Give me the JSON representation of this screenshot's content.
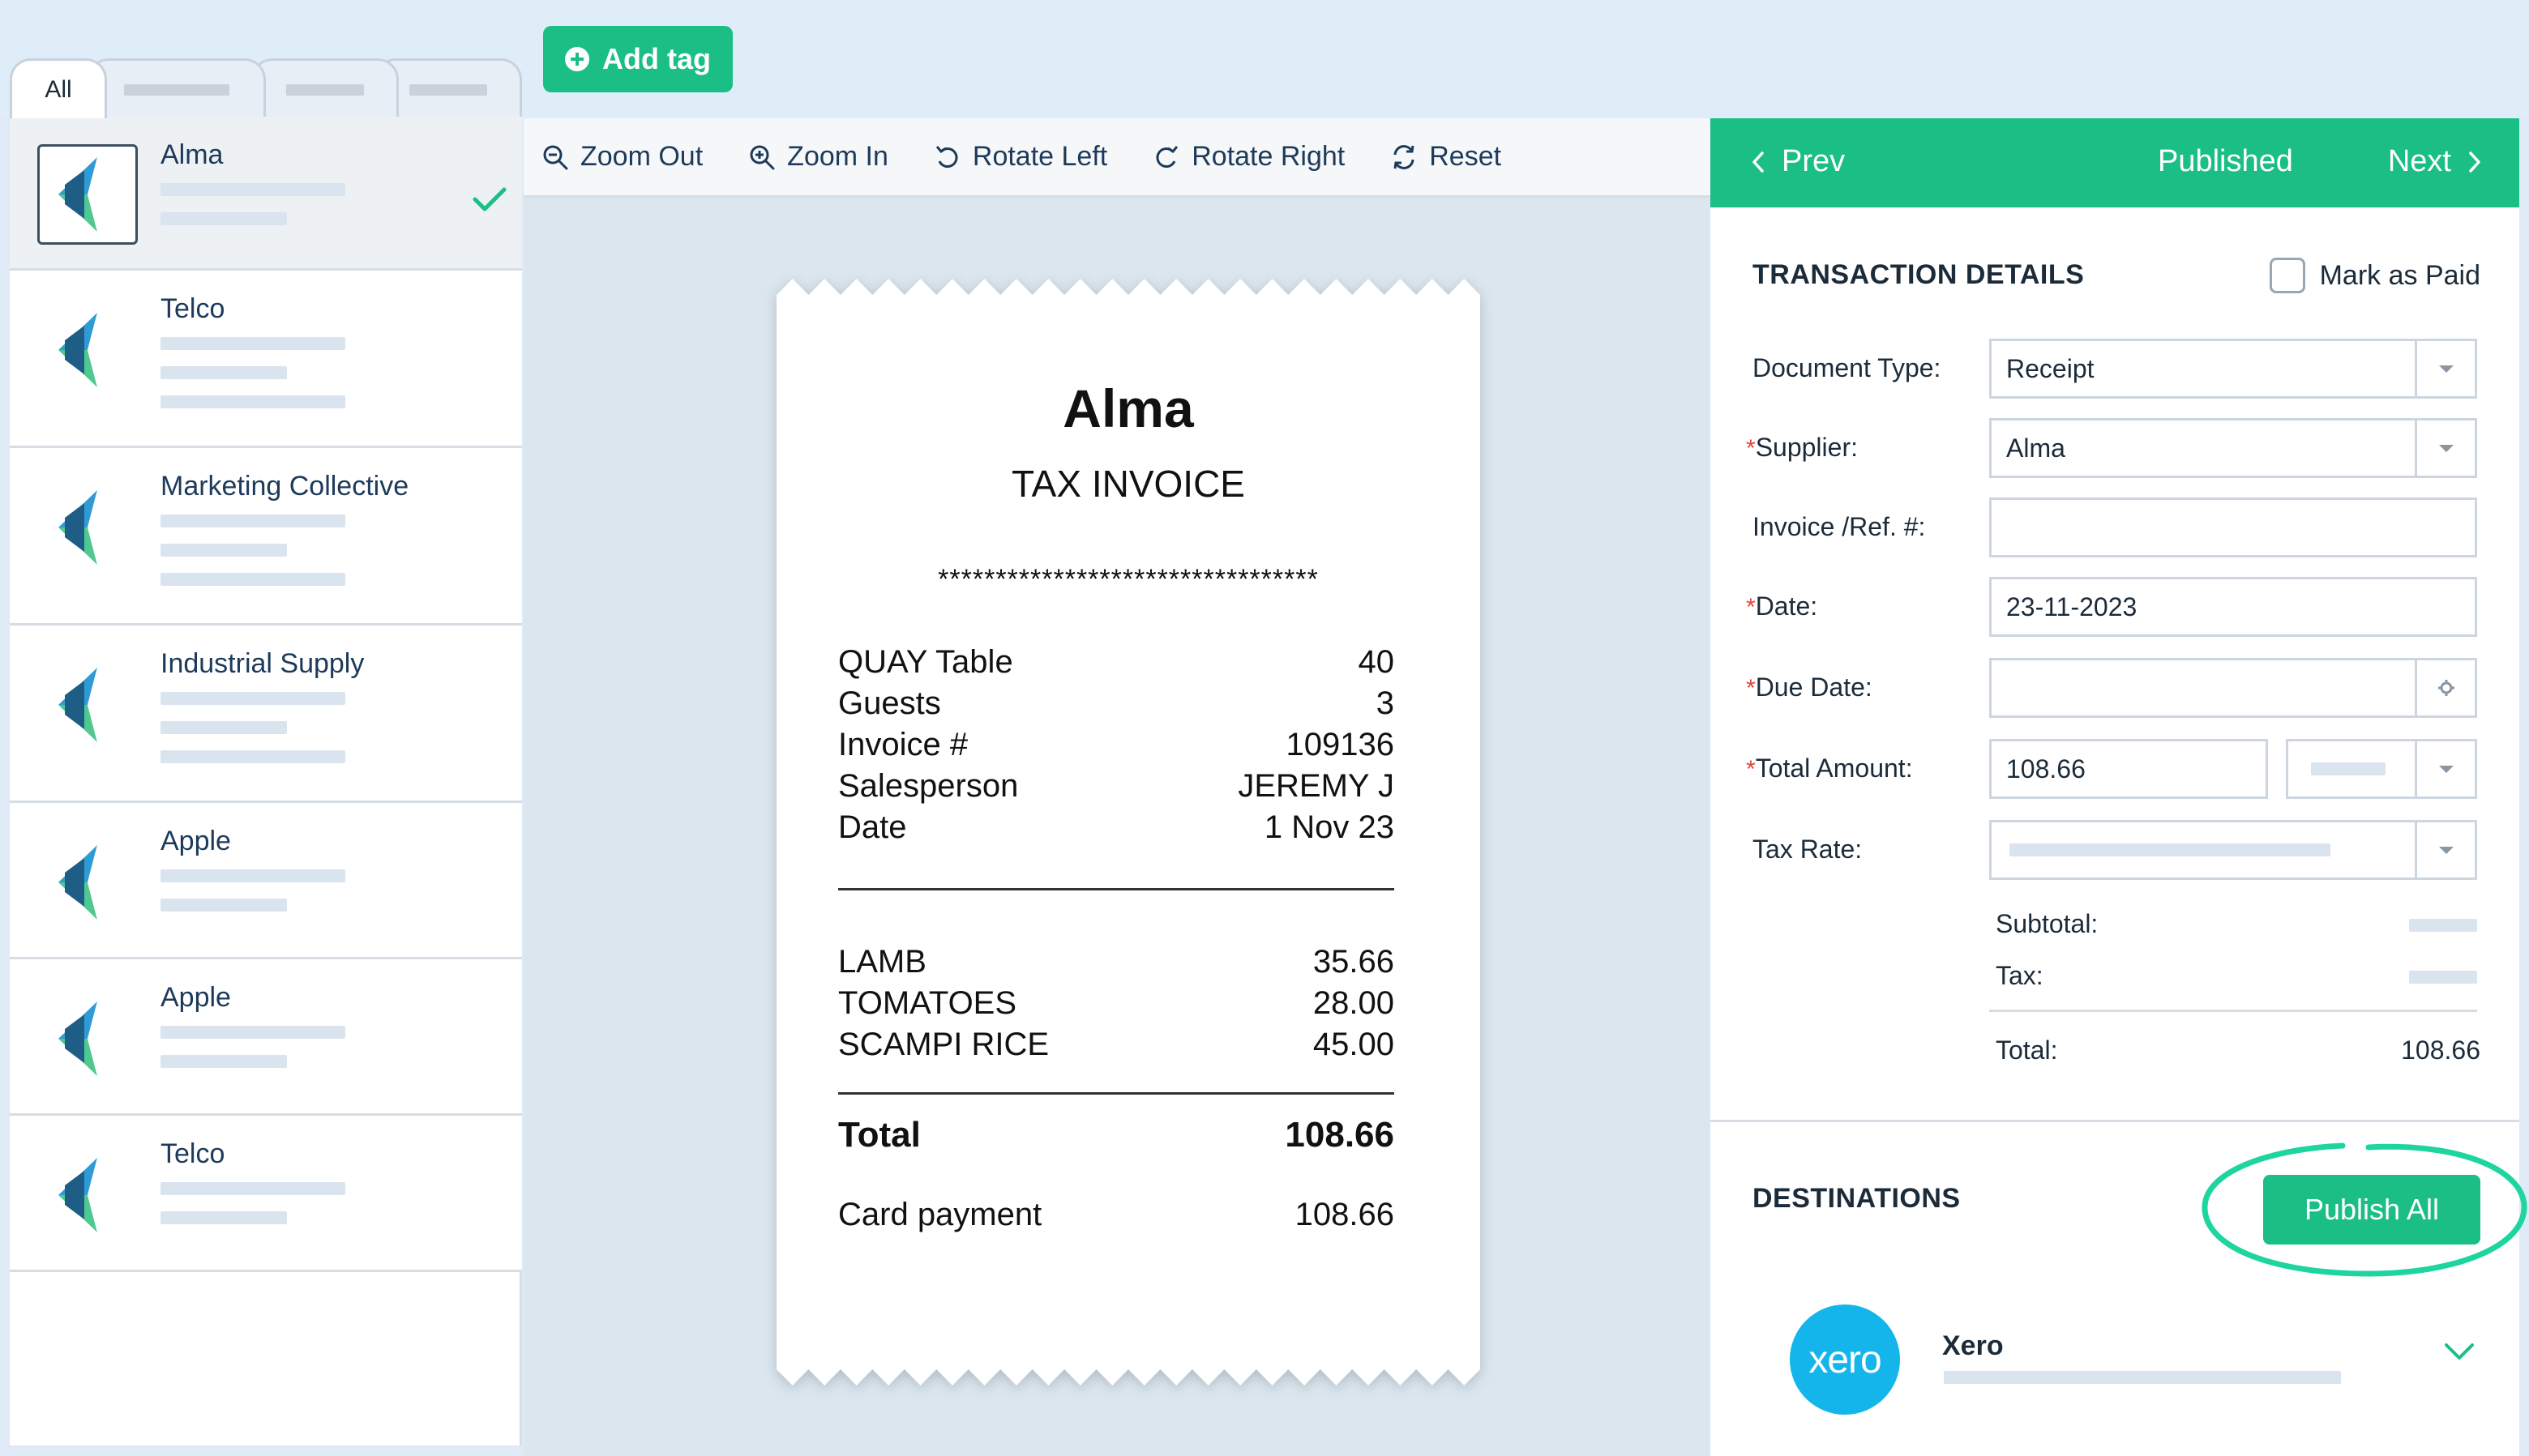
{
  "header": {
    "add_tag_label": "Add tag"
  },
  "tabs": [
    {
      "label": "All"
    }
  ],
  "documents": [
    {
      "name": "Alma",
      "selected": true
    },
    {
      "name": "Telco"
    },
    {
      "name": "Marketing Collective"
    },
    {
      "name": "Industrial Supply"
    },
    {
      "name": "Apple"
    },
    {
      "name": "Apple"
    },
    {
      "name": "Telco"
    }
  ],
  "toolbar": {
    "zoom_out": "Zoom Out",
    "zoom_in": "Zoom In",
    "rotate_left": "Rotate Left",
    "rotate_right": "Rotate Right",
    "reset": "Reset"
  },
  "receipt": {
    "title": "Alma",
    "subtitle": "TAX INVOICE",
    "stars": "*********************************",
    "info_rows": [
      {
        "label": "QUAY Table",
        "value": "40"
      },
      {
        "label": "Guests",
        "value": "3"
      },
      {
        "label": "Invoice #",
        "value": "109136"
      },
      {
        "label": "Salesperson",
        "value": "JEREMY J"
      },
      {
        "label": "Date",
        "value": "1 Nov 23"
      }
    ],
    "items": [
      {
        "label": "LAMB",
        "value": "35.66"
      },
      {
        "label": "TOMATOES",
        "value": "28.00"
      },
      {
        "label": "SCAMPI RICE",
        "value": "45.00"
      }
    ],
    "total_label": "Total",
    "total_value": "108.66",
    "payment_label": "Card payment",
    "payment_value": "108.66"
  },
  "panel": {
    "prev_label": "Prev",
    "status": "Published",
    "next_label": "Next",
    "transaction_title": "TRANSACTION DETAILS",
    "mark_paid_label": "Mark as Paid",
    "fields": {
      "document_type": {
        "label": "Document Type:",
        "value": "Receipt"
      },
      "supplier": {
        "label": "Supplier:",
        "value": "Alma"
      },
      "invoice_ref": {
        "label": "Invoice /Ref. #:",
        "value": ""
      },
      "date": {
        "label": "Date:",
        "value": "23-11-2023"
      },
      "due_date": {
        "label": "Due Date:",
        "value": ""
      },
      "total_amount": {
        "label": "Total Amount:",
        "value": "108.66"
      },
      "tax_rate": {
        "label": "Tax Rate:",
        "value": ""
      }
    },
    "required_mark": "*",
    "subtotal_label": "Subtotal:",
    "tax_label": "Tax:",
    "total_label": "Total:",
    "total_value": "108.66",
    "destinations_title": "DESTINATIONS",
    "publish_all_label": "Publish All",
    "destination": {
      "name": "Xero",
      "logo_text": "xero"
    }
  },
  "colors": {
    "brand_green": "#1bbf85",
    "xero_blue": "#13b5ea",
    "required_red": "#e0453d"
  }
}
